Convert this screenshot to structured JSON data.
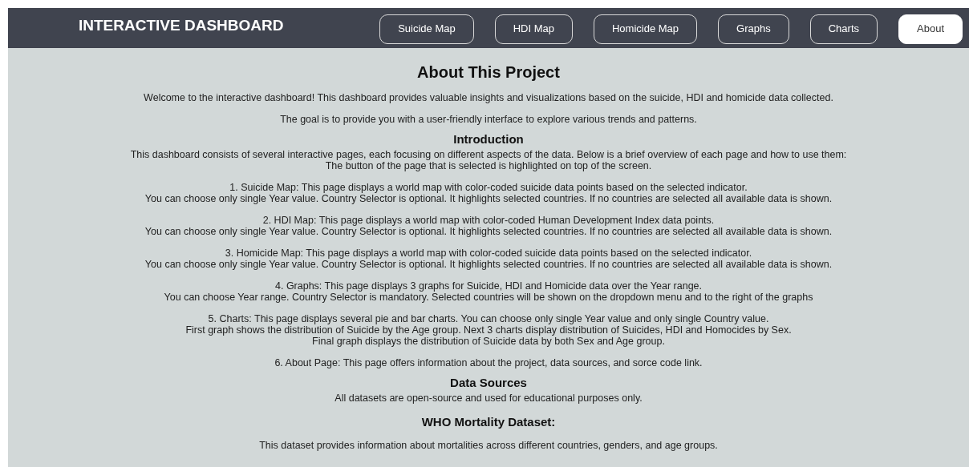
{
  "header": {
    "title": "INTERACTIVE DASHBOARD",
    "nav": [
      {
        "label": "Suicide Map",
        "selected": false
      },
      {
        "label": "HDI Map",
        "selected": false
      },
      {
        "label": "Homicide Map",
        "selected": false
      },
      {
        "label": "Graphs",
        "selected": false
      },
      {
        "label": "Charts",
        "selected": false
      },
      {
        "label": "About",
        "selected": true
      }
    ]
  },
  "content": [
    {
      "kind": "title",
      "text": "About This Project"
    },
    {
      "kind": "paragraph",
      "lines": [
        "Welcome to the interactive dashboard! This dashboard provides valuable insights and visualizations based on the suicide, HDI and homicide data collected."
      ]
    },
    {
      "kind": "paragraph",
      "lines": [
        "The goal is to provide you with a user-friendly interface to explore various trends and patterns."
      ]
    },
    {
      "kind": "heading",
      "text": "Introduction"
    },
    {
      "kind": "paragraph",
      "lines": [
        "This dashboard consists of several interactive pages, each focusing on different aspects of the data. Below is a brief overview of each page and how to use them:",
        "The button of the page that is selected is highlighted on top of the screen."
      ]
    },
    {
      "kind": "paragraph",
      "lines": [
        "1. Suicide Map: This page displays a world map with color-coded suicide data points based on the selected indicator.",
        "You can choose only single Year value. Country Selector is optional. It highlights selected countries. If no countries are selected all available data is shown."
      ]
    },
    {
      "kind": "paragraph",
      "lines": [
        "2. HDI Map: This page displays a world map with color-coded Human Development Index data points.",
        "You can choose only single Year value. Country Selector is optional. It highlights selected countries. If no countries are selected all available data is shown."
      ]
    },
    {
      "kind": "paragraph",
      "lines": [
        "3. Homicide Map: This page displays a world map with color-coded suicide data points based on the selected indicator.",
        "You can choose only single Year value. Country Selector is optional. It highlights selected countries. If no countries are selected all available data is shown."
      ]
    },
    {
      "kind": "paragraph",
      "lines": [
        "4. Graphs: This page displays 3 graphs for Suicide, HDI and Homicide data over the Year range.",
        "You can choose Year range. Country Selector is mandatory. Selected countries will be shown on the dropdown menu and to the right of the graphs"
      ]
    },
    {
      "kind": "paragraph",
      "lines": [
        "5. Charts: This page displays several pie and bar charts. You can choose only single Year value and only single Country value.",
        "First graph shows the distribution of Suicide by the Age group. Next 3 charts display distribution of Suicides, HDI and Homocides by Sex.",
        "Final graph displays the distribution of Suicide data by both Sex and Age group."
      ]
    },
    {
      "kind": "paragraph",
      "lines": [
        "6. About Page: This page offers information about the project, data sources, and sorce code link."
      ]
    },
    {
      "kind": "heading",
      "text": "Data Sources"
    },
    {
      "kind": "paragraph",
      "lines": [
        "All datasets are open-source and used for educational purposes only."
      ]
    },
    {
      "kind": "subheading",
      "text": "WHO Mortality Dataset:"
    },
    {
      "kind": "paragraph",
      "lines": [
        "This dataset provides information about mortalities across different countries, genders, and age groups."
      ]
    }
  ]
}
